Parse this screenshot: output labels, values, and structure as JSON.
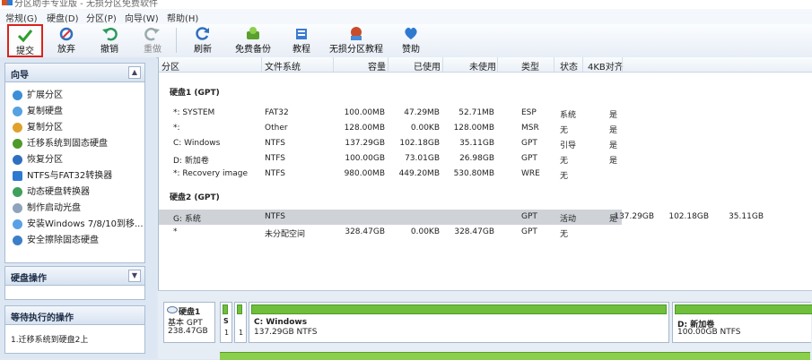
{
  "window": {
    "title": "分区助手专业版 - 无损分区免费软件"
  },
  "menu": [
    "常规(G)",
    "硬盘(D)",
    "分区(P)",
    "向导(W)",
    "帮助(H)"
  ],
  "toolbar": [
    {
      "label": "提交",
      "icon": "check-icon",
      "state": "active"
    },
    {
      "label": "放弃",
      "icon": "discard-icon",
      "state": "normal"
    },
    {
      "label": "撤销",
      "icon": "undo-icon",
      "state": "normal"
    },
    {
      "label": "重做",
      "icon": "redo-icon",
      "state": "disabled"
    },
    {
      "label": "刷新",
      "icon": "refresh-icon",
      "state": "normal"
    },
    {
      "label": "免费备份",
      "icon": "backup-icon",
      "state": "normal"
    },
    {
      "label": "教程",
      "icon": "tutorial-icon",
      "state": "normal"
    },
    {
      "label": "无损分区教程",
      "icon": "lossless-tutorial-icon",
      "state": "normal"
    },
    {
      "label": "赞助",
      "icon": "heart-icon",
      "state": "normal"
    }
  ],
  "wizard": {
    "title": "向导",
    "items": [
      "扩展分区",
      "复制硬盘",
      "复制分区",
      "迁移系统到固态硬盘",
      "恢复分区",
      "NTFS与FAT32转换器",
      "动态硬盘转换器",
      "制作启动光盘",
      "安装Windows 7/8/10到移...",
      "安全擦除固态硬盘"
    ]
  },
  "disk_ops": {
    "title": "硬盘操作"
  },
  "pending": {
    "title": "等待执行的操作",
    "items": [
      "1.迁移系统到硬盘2上"
    ]
  },
  "table": {
    "columns": [
      "分区",
      "文件系统",
      "容量",
      "已使用",
      "未使用",
      "类型",
      "状态",
      "4KB对齐"
    ],
    "groups": [
      {
        "name": "硬盘1 (GPT)",
        "rows": [
          [
            "*: SYSTEM",
            "FAT32",
            "100.00MB",
            "47.29MB",
            "52.71MB",
            "ESP",
            "系统",
            "是"
          ],
          [
            "*:",
            "Other",
            "128.00MB",
            "0.00KB",
            "128.00MB",
            "MSR",
            "无",
            "是"
          ],
          [
            "C: Windows",
            "NTFS",
            "137.29GB",
            "102.18GB",
            "35.11GB",
            "GPT",
            "引导",
            "是"
          ],
          [
            "D: 新加卷",
            "NTFS",
            "100.00GB",
            "73.01GB",
            "26.98GB",
            "GPT",
            "无",
            "是"
          ],
          [
            "*: Recovery image",
            "NTFS",
            "980.00MB",
            "449.20MB",
            "530.80MB",
            "WRE",
            "无",
            ""
          ]
        ]
      },
      {
        "name": "硬盘2 (GPT)",
        "rows": [
          [
            "G: 系统",
            "NTFS",
            "137.29GB",
            "102.18GB",
            "35.11GB",
            "GPT",
            "活动",
            "是"
          ],
          [
            "*",
            "未分配空间",
            "328.47GB",
            "0.00KB",
            "328.47GB",
            "GPT",
            "无",
            ""
          ]
        ]
      }
    ],
    "selected_row": "G: 系统"
  },
  "diskmap": {
    "disk": {
      "name": "硬盘1",
      "type": "基本 GPT",
      "size": "238.47GB"
    },
    "small_parts": [
      {
        "top": "S",
        "bottom": "1"
      },
      {
        "top": "",
        "bottom": "1"
      }
    ],
    "partitions": [
      {
        "name": "C: Windows",
        "info": "137.29GB NTFS",
        "used": 0.74
      },
      {
        "name": "D: 新加卷",
        "info": "100.00GB NTFS",
        "used": 0.73
      }
    ]
  },
  "colors": {
    "highlight_border": "#d9231e",
    "used_bar": "#6fbf3c",
    "selected_row": "#cfd3d8"
  }
}
